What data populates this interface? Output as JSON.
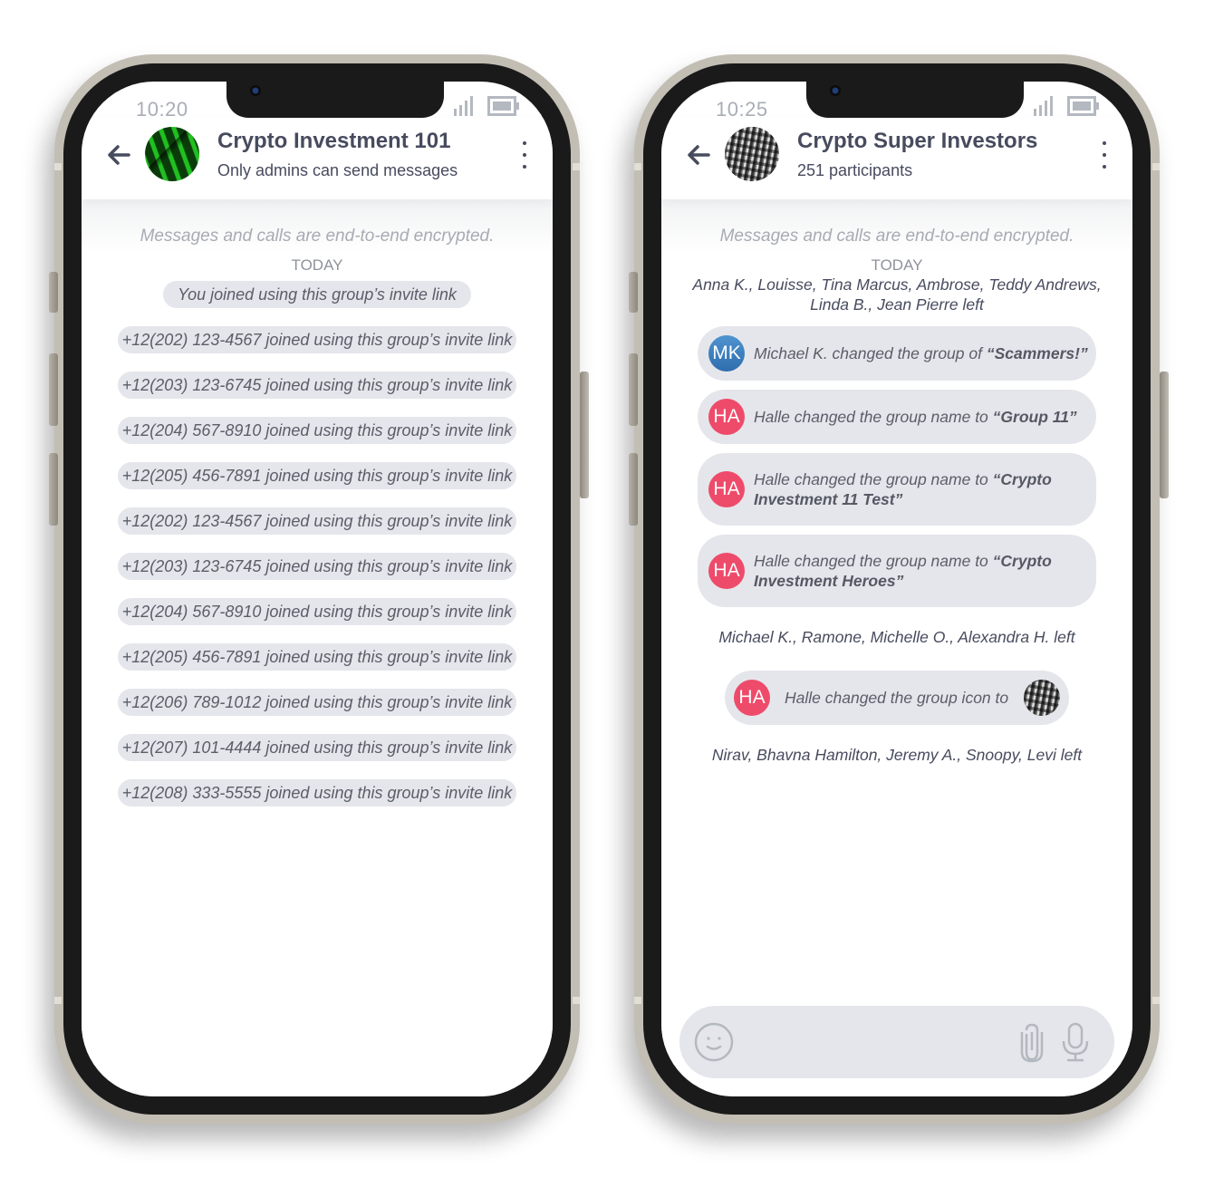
{
  "phones": [
    {
      "status": {
        "time": "10:20"
      },
      "header": {
        "title": "Crypto Investment 101",
        "subtitle": "Only admins can send messages"
      },
      "chat": {
        "encryption_notice": "Messages and calls are end-to-end encrypted.",
        "date_label": "TODAY",
        "messages": [
          "You joined using this group’s invite link",
          "+12(202) 123-4567 joined using this group’s invite link",
          "+12(203) 123-6745 joined using this group’s invite link",
          "+12(204) 567-8910 joined using this group’s invite link",
          "+12(205) 456-7891 joined using this group’s invite link",
          "+12(202) 123-4567 joined using this group’s invite link",
          "+12(203) 123-6745 joined using this group’s invite link",
          "+12(204) 567-8910 joined using this group’s invite link",
          "+12(205) 456-7891 joined using this group’s invite link",
          "+12(206) 789-1012 joined using this group’s invite link",
          "+12(207) 101-4444 joined using this group’s invite link",
          "+12(208) 333-5555 joined using this group’s invite link"
        ]
      }
    },
    {
      "status": {
        "time": "10:25"
      },
      "header": {
        "title": "Crypto Super Investors",
        "subtitle": "251 participants"
      },
      "chat": {
        "encryption_notice": "Messages and calls are end-to-end encrypted.",
        "date_label": "TODAY",
        "left_notice_1": "Anna K., Louisse, Tina Marcus, Ambrose, Teddy Andrews, Linda B., Jean Pierre left",
        "events": [
          {
            "initials": "MK",
            "color": "#3a7fc0",
            "text": "Michael K. changed the group of ",
            "highlight": "“Scammers!”"
          },
          {
            "initials": "HA",
            "color": "#ee4b6b",
            "text": "Halle changed the group name to ",
            "highlight": "“Group 11”"
          },
          {
            "initials": "HA",
            "color": "#ee4b6b",
            "text": "Halle changed the group name to ",
            "highlight": "“Crypto Investment 11 Test”"
          },
          {
            "initials": "HA",
            "color": "#ee4b6b",
            "text": "Halle changed the group name to ",
            "highlight": "“Crypto Investment Heroes”"
          }
        ],
        "left_notice_2": "Michael K., Ramone, Michelle O., Alexandra H. left",
        "icon_event": {
          "initials": "HA",
          "text": "Halle changed the group icon to"
        },
        "left_notice_3": "Nirav, Bhavna Hamilton, Jeremy A., Snoopy, Levi left"
      },
      "composer": {
        "placeholder": ""
      }
    }
  ],
  "icons": {
    "back": "arrow-left",
    "menu": "more-vertical",
    "wifi": "wifi",
    "signal": "cellular-signal",
    "battery": "battery",
    "emoji": "smiley",
    "attach": "paperclip",
    "mic": "microphone"
  },
  "colors": {
    "frame": "#c3beb4",
    "bezel": "#1a1a1a",
    "pill_bg": "#e5e6eb",
    "header_text": "#474b5e",
    "avatar_mk": "#3a7fc0",
    "avatar_ha": "#ee4b6b"
  }
}
